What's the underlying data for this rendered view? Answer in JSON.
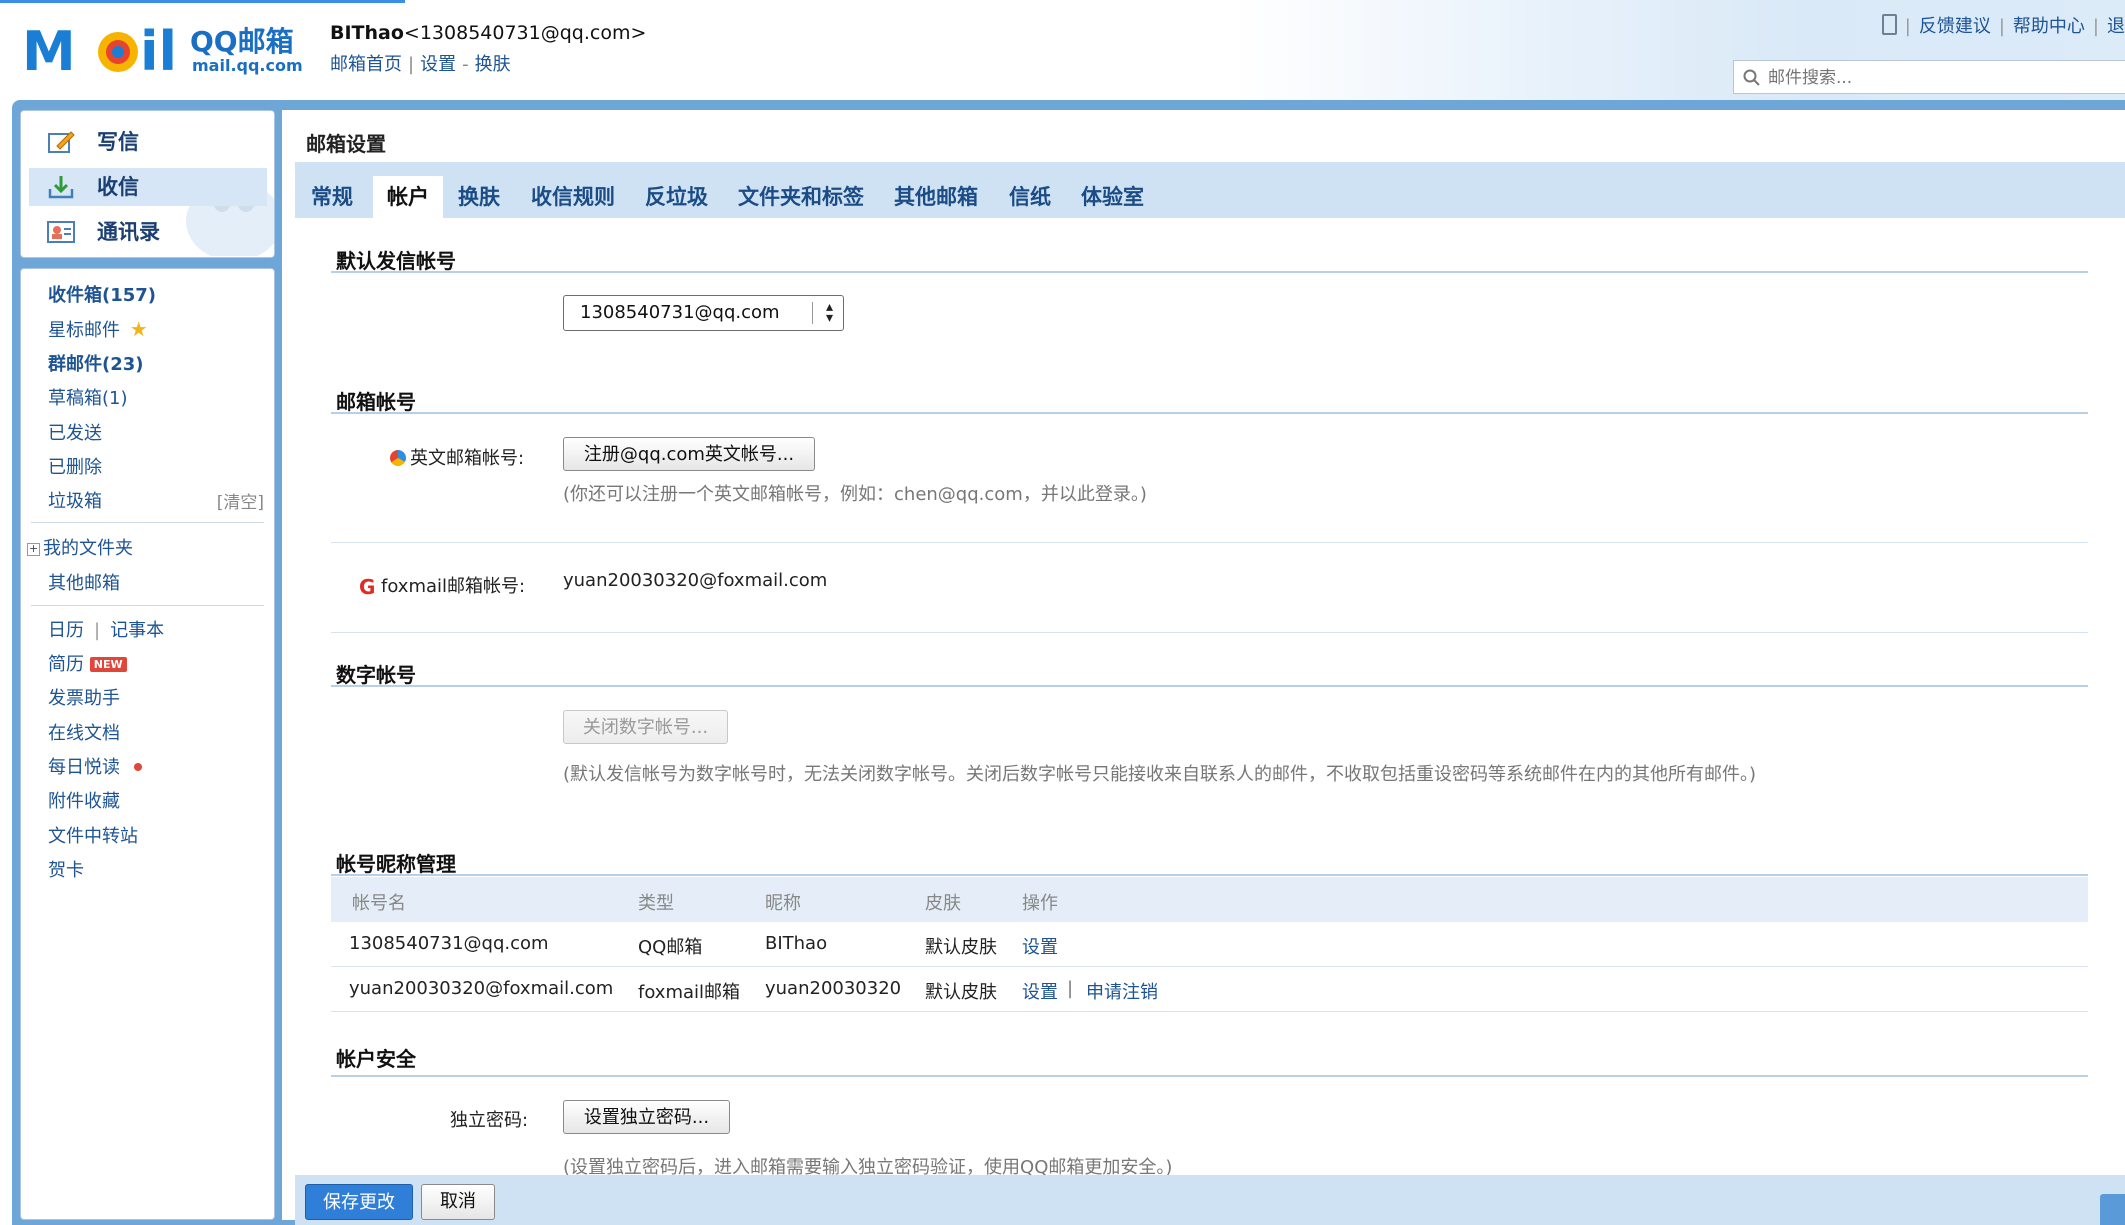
{
  "header": {
    "logo_text": "QQ邮箱",
    "logo_sub": "mail.qq.com",
    "user_name": "BIThao",
    "user_email": "<1308540731@qq.com>",
    "links": [
      "邮箱首页",
      "设置",
      "换肤"
    ],
    "top_right": [
      "反馈建议",
      "帮助中心",
      "退"
    ],
    "search_placeholder": "邮件搜索..."
  },
  "quick_actions": [
    {
      "label": "写信",
      "icon": "compose-icon"
    },
    {
      "label": "收信",
      "icon": "inbox-download-icon"
    },
    {
      "label": "通讯录",
      "icon": "contacts-icon"
    }
  ],
  "folders": {
    "inbox": "收件箱(157)",
    "starred": "星标邮件",
    "group": "群邮件(23)",
    "drafts": "草稿箱(1)",
    "sent": "已发送",
    "deleted": "已删除",
    "trash": "垃圾箱",
    "trash_clear": "[清空]",
    "my_folders": "我的文件夹",
    "other_mailbox": "其他邮箱",
    "calendar": "日历",
    "notepad": "记事本",
    "resume": "简历",
    "new_badge": "NEW",
    "invoice": "发票助手",
    "online_docs": "在线文档",
    "daily_read": "每日悦读",
    "attachments": "附件收藏",
    "transfer": "文件中转站",
    "cards": "贺卡"
  },
  "content": {
    "title": "邮箱设置",
    "tabs": [
      "常规",
      "帐户",
      "换肤",
      "收信规则",
      "反垃圾",
      "文件夹和标签",
      "其他邮箱",
      "信纸",
      "体验室"
    ],
    "active_tab": "帐户",
    "default_send": {
      "title": "默认发信帐号",
      "selected": "1308540731@qq.com"
    },
    "mail_account": {
      "title": "邮箱帐号",
      "english_label": "英文邮箱帐号:",
      "english_button": "注册@qq.com英文帐号...",
      "english_hint": "(你还可以注册一个英文邮箱帐号，例如：chen@qq.com，并以此登录。)",
      "foxmail_label": "foxmail邮箱帐号:",
      "foxmail_value": "yuan20030320@foxmail.com"
    },
    "digital_account": {
      "title": "数字帐号",
      "button": "关闭数字帐号...",
      "hint": "(默认发信帐号为数字帐号时，无法关闭数字帐号。关闭后数字帐号只能接收来自联系人的邮件，不收取包括重设密码等系统邮件在内的其他所有邮件。)"
    },
    "nickname": {
      "title": "帐号昵称管理",
      "columns": [
        "帐号名",
        "类型",
        "昵称",
        "皮肤",
        "操作"
      ],
      "rows": [
        {
          "account": "1308540731@qq.com",
          "type": "QQ邮箱",
          "nickname": "BIThao",
          "skin": "默认皮肤",
          "action1": "设置",
          "action2": ""
        },
        {
          "account": "yuan20030320@foxmail.com",
          "type": "foxmail邮箱",
          "nickname": "yuan20030320",
          "skin": "默认皮肤",
          "action1": "设置",
          "action2": "申请注销"
        }
      ]
    },
    "security": {
      "title": "帐户安全",
      "label": "独立密码:",
      "button": "设置独立密码...",
      "hint": "(设置独立密码后，进入邮箱需要输入独立密码验证，使用QQ邮箱更加安全。)"
    }
  },
  "footer": {
    "save": "保存更改",
    "cancel": "取消"
  },
  "colors": {
    "frame": "#6fa6d8",
    "tab_bar": "#cfe2f4",
    "link": "#1e5494",
    "primary_button": "#2f7fd8"
  }
}
